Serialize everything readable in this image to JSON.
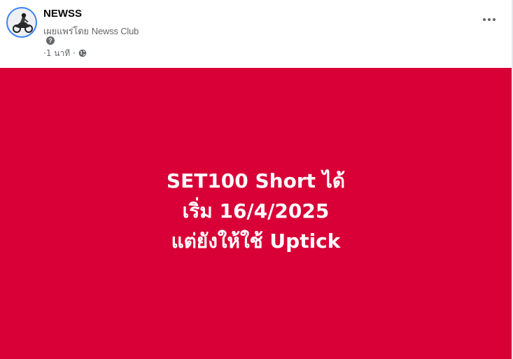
{
  "post": {
    "page_name": "NEWSS",
    "published_by_prefix": "เผยแพร่โดย ",
    "published_by_name": "Newss Club",
    "help_glyph": "?",
    "timestamp": "1 นาที",
    "separator_leading": "·",
    "separator_trailing": "·",
    "audience_icon": "globe-icon",
    "more_icon": "more-horizontal-icon",
    "avatar_icon": "motorcycle-rider-icon"
  },
  "content": {
    "background_color": "#d80036",
    "text_color": "#ffffff",
    "lines": [
      "SET100 Short ได้",
      "เริ่ม 16/4/2025",
      "แต่ยังให้ใช้ Uptick"
    ]
  }
}
